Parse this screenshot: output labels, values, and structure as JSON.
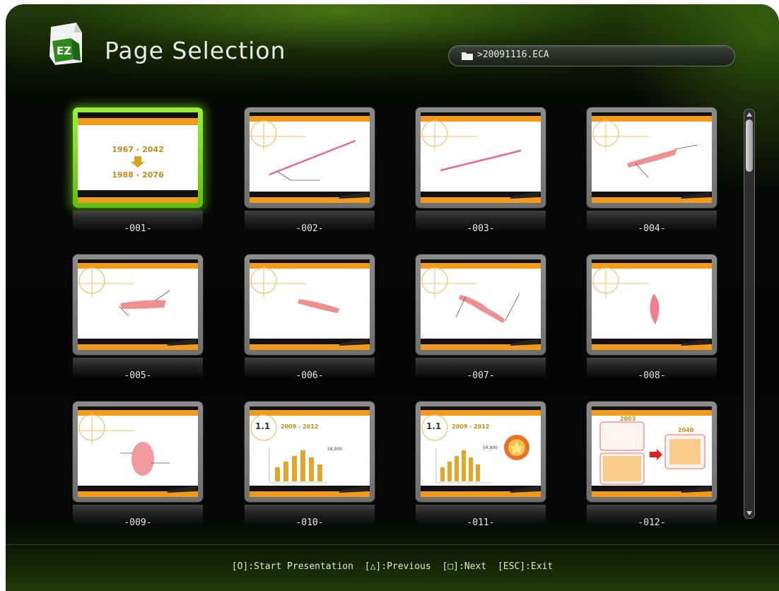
{
  "header": {
    "title": "Page Selection",
    "logo_text": "EZ",
    "path": ">20091116.ECA"
  },
  "pages": [
    {
      "label": "-001-",
      "selected": true
    },
    {
      "label": "-002-",
      "selected": false
    },
    {
      "label": "-003-",
      "selected": false
    },
    {
      "label": "-004-",
      "selected": false
    },
    {
      "label": "-005-",
      "selected": false
    },
    {
      "label": "-006-",
      "selected": false
    },
    {
      "label": "-007-",
      "selected": false
    },
    {
      "label": "-008-",
      "selected": false
    },
    {
      "label": "-009-",
      "selected": false
    },
    {
      "label": "-010-",
      "selected": false
    },
    {
      "label": "-011-",
      "selected": false
    },
    {
      "label": "-012-",
      "selected": false
    }
  ],
  "slides": {
    "s1": {
      "line1": "1967 - 2042",
      "line2": "1988 - 2076"
    },
    "s10": {
      "num": "1.1",
      "years": "2009 - 2012",
      "callout": "58,900"
    },
    "s11": {
      "num": "1.1",
      "years": "2009 - 2012",
      "callout": "58,900"
    },
    "s12": {
      "year_a": "2003",
      "year_b": "2040"
    }
  },
  "footer": {
    "start": "[O]:Start Presentation",
    "previous": "[△]:Previous",
    "next": "[□]:Next",
    "exit": "[ESC]:Exit"
  },
  "colors": {
    "accent_green": "#7fd61f",
    "slide_orange": "#f39a1a",
    "slide_bar": "#111111"
  }
}
